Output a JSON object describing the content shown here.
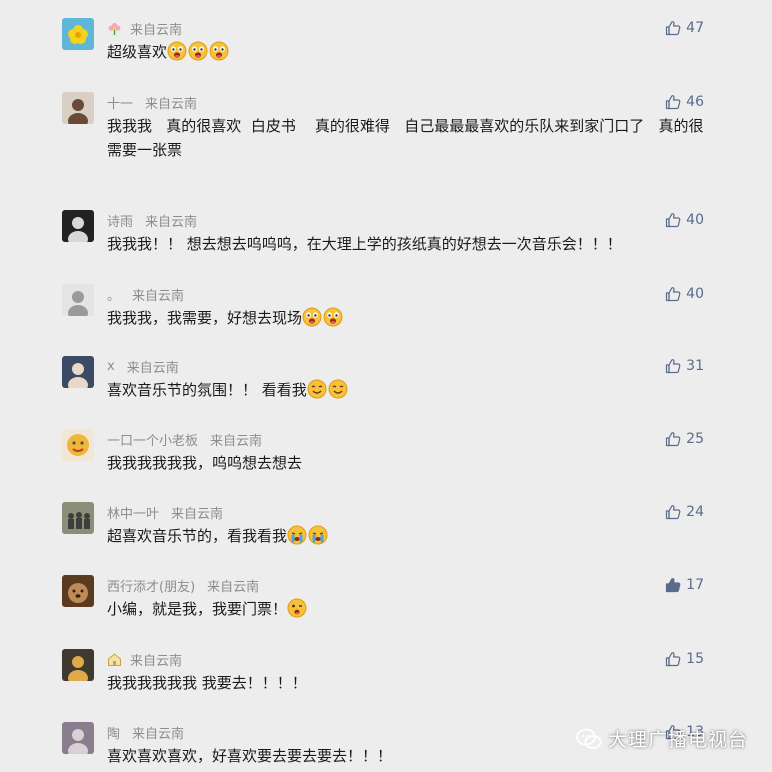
{
  "comments": [
    {
      "nickname": "",
      "has_badge": true,
      "badge_icon": "flower-icon",
      "location": "来自云南",
      "text_parts": [
        "超级喜欢"
      ],
      "emojis": [
        "tongue-emoji",
        "tongue-emoji",
        "tongue-emoji"
      ],
      "likes": "47",
      "liked": false,
      "avatar": {
        "bg": "#5fb6d8",
        "fg": "#f5d21c",
        "shape": "flower"
      }
    },
    {
      "nickname": "十一",
      "location": "来自云南",
      "text_parts": [
        "我我我   真的很喜欢  白皮书    真的很难得   自己最最最喜欢的乐队来到家门口了   真的很需要一张票"
      ],
      "emojis": [],
      "likes": "46",
      "liked": false,
      "avatar": {
        "bg": "#d9cfc4",
        "fg": "#6a4a36",
        "shape": "person"
      }
    },
    {
      "nickname": "诗雨",
      "location": "来自云南",
      "text_parts": [
        "我我我！！ 想去想去呜呜呜，在大理上学的孩纸真的好想去一次音乐会！！！"
      ],
      "emojis": [],
      "likes": "40",
      "liked": false,
      "avatar": {
        "bg": "#222222",
        "fg": "#d8d8d8",
        "shape": "person"
      }
    },
    {
      "nickname": "。",
      "location": "来自云南",
      "text_parts": [
        "我我我，我需要，好想去现场"
      ],
      "emojis": [
        "tongue-emoji",
        "tongue-emoji"
      ],
      "likes": "40",
      "liked": false,
      "avatar": {
        "bg": "#e4e4e4",
        "fg": "#9a9a9a",
        "shape": "person"
      }
    },
    {
      "nickname": "x",
      "location": "来自云南",
      "text_parts": [
        "喜欢音乐节的氛围！！ 看看我"
      ],
      "emojis": [
        "smile-emoji",
        "smile-emoji"
      ],
      "likes": "31",
      "liked": false,
      "avatar": {
        "bg": "#3c4a66",
        "fg": "#e9d8c8",
        "shape": "person"
      }
    },
    {
      "nickname": "一口一个小老板",
      "location": "来自云南",
      "text_parts": [
        "我我我我我我，呜呜想去想去"
      ],
      "emojis": [],
      "likes": "25",
      "liked": false,
      "avatar": {
        "bg": "#f2e6d6",
        "fg": "#f0b63a",
        "shape": "face"
      }
    },
    {
      "nickname": "林中一叶",
      "location": "来自云南",
      "text_parts": [
        "超喜欢音乐节的，看我看我"
      ],
      "emojis": [
        "cry-emoji",
        "cry-emoji"
      ],
      "likes": "24",
      "liked": false,
      "avatar": {
        "bg": "#8b8f7a",
        "fg": "#3d3d3d",
        "shape": "group"
      }
    },
    {
      "nickname": "西行添才(朋友)",
      "location": "来自云南",
      "text_parts": [
        "小编，就是我，我要门票！"
      ],
      "emojis": [
        "wink-emoji"
      ],
      "likes": "17",
      "liked": true,
      "avatar": {
        "bg": "#5a3b22",
        "fg": "#c08a55",
        "shape": "dog"
      }
    },
    {
      "nickname": "",
      "has_badge": true,
      "badge_icon": "house-icon",
      "location": "来自云南",
      "text_parts": [
        "我我我我我我 我要去！！！！"
      ],
      "emojis": [],
      "likes": "15",
      "liked": false,
      "avatar": {
        "bg": "#3e3a30",
        "fg": "#e0a94a",
        "shape": "person"
      }
    },
    {
      "nickname": "陶",
      "location": "来自云南",
      "text_parts": [
        "喜欢喜欢喜欢，好喜欢要去要去要去！！！"
      ],
      "emojis": [],
      "likes": "13",
      "liked": false,
      "avatar": {
        "bg": "#8a7e8e",
        "fg": "#d9cfd6",
        "shape": "person"
      }
    }
  ],
  "watermark": {
    "label": "大理广播电视台",
    "icon": "wechat-icon"
  },
  "colors": {
    "background": "#ededed",
    "meta": "#8d8d8d",
    "text": "#1a1a1a",
    "like": "#5a6b8c",
    "liked": "#5a6b8c"
  }
}
